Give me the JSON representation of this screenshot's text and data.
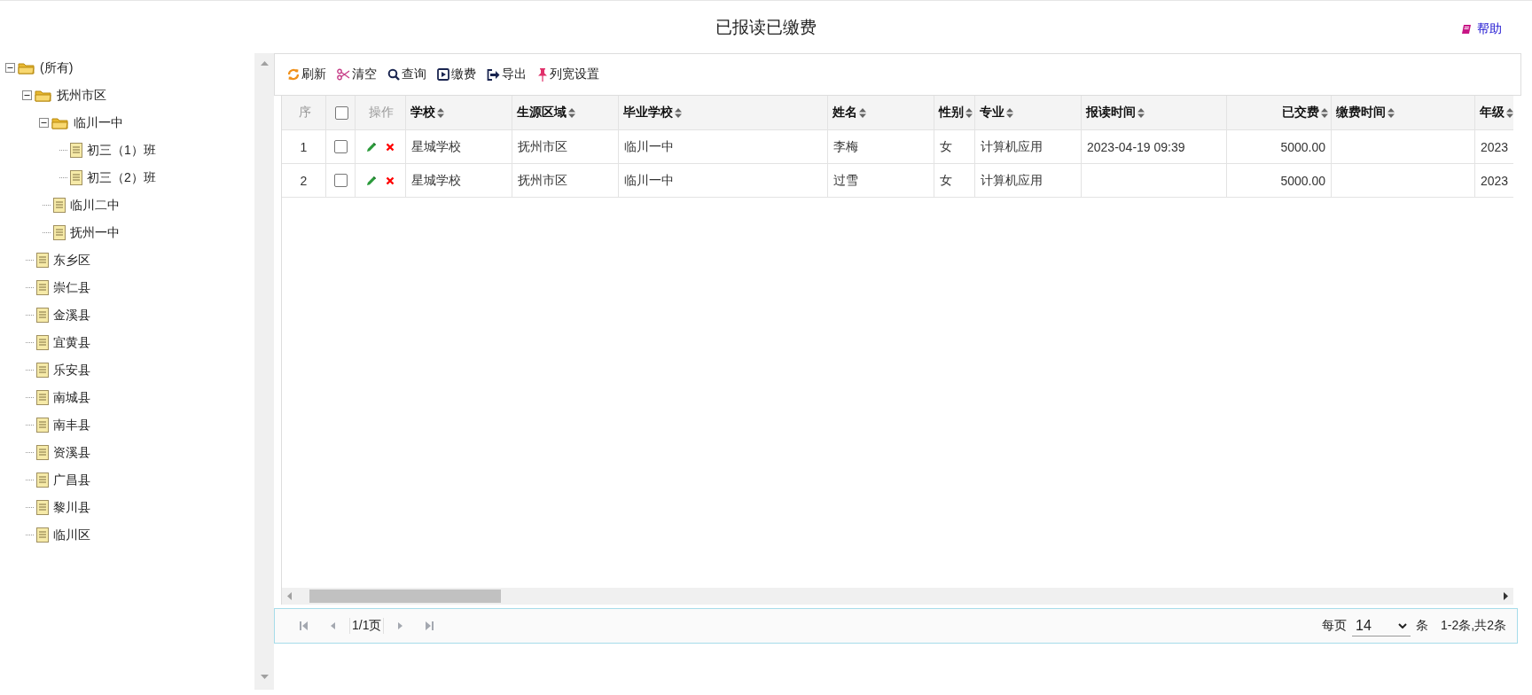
{
  "page": {
    "title": "已报读已缴费",
    "help": "帮助"
  },
  "tree": [
    {
      "label": "(所有)",
      "kind": "folder",
      "expanded": true,
      "children": [
        {
          "label": "抚州市区",
          "kind": "folder",
          "expanded": true,
          "children": [
            {
              "label": "临川一中",
              "kind": "folder",
              "expanded": true,
              "children": [
                {
                  "label": "初三（1）班",
                  "kind": "leaf"
                },
                {
                  "label": "初三（2）班",
                  "kind": "leaf"
                }
              ]
            },
            {
              "label": "临川二中",
              "kind": "leaf"
            },
            {
              "label": "抚州一中",
              "kind": "leaf"
            }
          ]
        },
        {
          "label": "东乡区",
          "kind": "leaf"
        },
        {
          "label": "崇仁县",
          "kind": "leaf"
        },
        {
          "label": "金溪县",
          "kind": "leaf"
        },
        {
          "label": "宜黄县",
          "kind": "leaf"
        },
        {
          "label": "乐安县",
          "kind": "leaf"
        },
        {
          "label": "南城县",
          "kind": "leaf"
        },
        {
          "label": "南丰县",
          "kind": "leaf"
        },
        {
          "label": "资溪县",
          "kind": "leaf"
        },
        {
          "label": "广昌县",
          "kind": "leaf"
        },
        {
          "label": "黎川县",
          "kind": "leaf"
        },
        {
          "label": "临川区",
          "kind": "leaf"
        }
      ]
    }
  ],
  "toolbar": [
    {
      "kind": "refresh",
      "label": "刷新"
    },
    {
      "kind": "clear",
      "label": "清空"
    },
    {
      "kind": "search",
      "label": "查询"
    },
    {
      "kind": "pay",
      "label": "缴费"
    },
    {
      "kind": "export",
      "label": "导出"
    },
    {
      "kind": "pin",
      "label": "列宽设置"
    }
  ],
  "table": {
    "columns": [
      {
        "kind": "index",
        "label": "序"
      },
      {
        "kind": "check",
        "checked": false
      },
      {
        "kind": "actions",
        "label": "操作"
      },
      {
        "kind": "text",
        "label": "学校",
        "sortable": true
      },
      {
        "kind": "text",
        "label": "生源区域",
        "sortable": true
      },
      {
        "kind": "text",
        "label": "毕业学校",
        "sortable": true
      },
      {
        "kind": "text",
        "label": "姓名",
        "sortable": true
      },
      {
        "kind": "text",
        "label": "性别",
        "sortable": true
      },
      {
        "kind": "text",
        "label": "专业",
        "sortable": true
      },
      {
        "kind": "text",
        "label": "报读时间",
        "sortable": true
      },
      {
        "kind": "number",
        "label": "已交费",
        "sortable": true
      },
      {
        "kind": "text",
        "label": "缴费时间",
        "sortable": true
      },
      {
        "kind": "text",
        "label": "年级",
        "sortable": true
      }
    ],
    "rows": [
      {
        "checked": false,
        "cells": [
          "1",
          "",
          "",
          "星城学校",
          "抚州市区",
          "临川一中",
          "李梅",
          "女",
          "计算机应用",
          "2023-04-19 09:39",
          "5000.00",
          "",
          "2023"
        ]
      },
      {
        "checked": false,
        "cells": [
          "2",
          "",
          "",
          "星城学校",
          "抚州市区",
          "临川一中",
          "过雪",
          "女",
          "计算机应用",
          "",
          "5000.00",
          "",
          "2023"
        ]
      }
    ]
  },
  "pager": {
    "page": "1/1页",
    "per_page_label": "每页",
    "per_page": "14",
    "unit": "条",
    "summary": "1-2条,共2条"
  }
}
